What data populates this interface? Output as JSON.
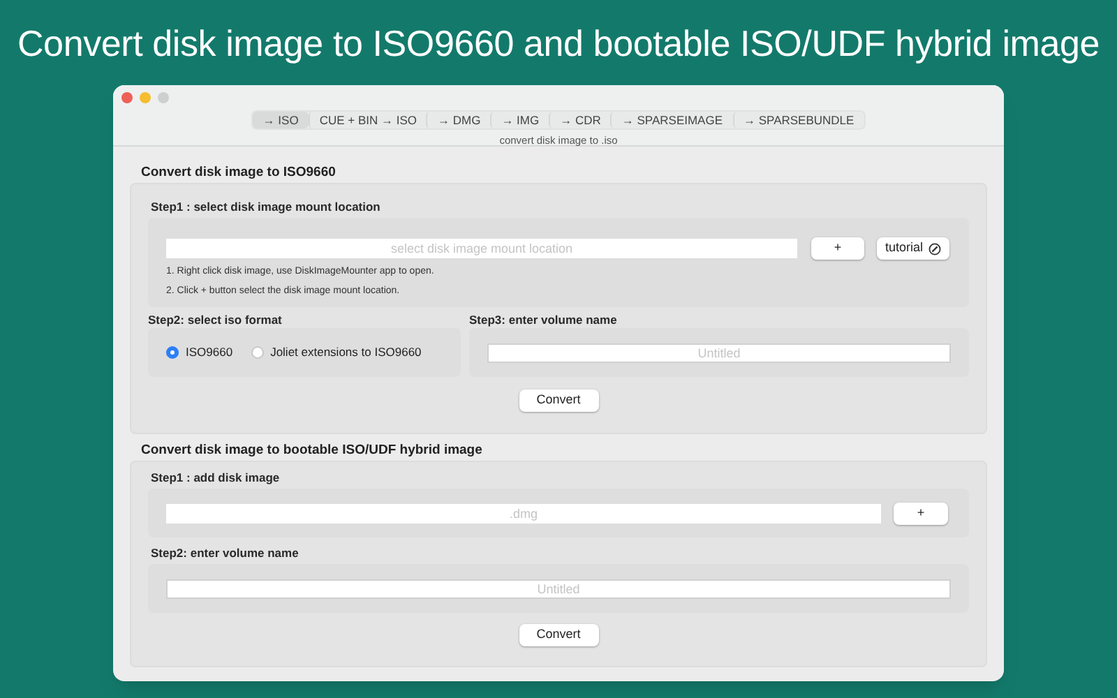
{
  "headline": "Convert disk image to ISO9660 and bootable ISO/UDF hybrid image",
  "window": {
    "tabs": [
      {
        "label": "→ ISO",
        "selected": true
      },
      {
        "label": "CUE + BIN → ISO",
        "selected": false
      },
      {
        "label": "→ DMG",
        "selected": false
      },
      {
        "label": "→ IMG",
        "selected": false
      },
      {
        "label": "→ CDR",
        "selected": false
      },
      {
        "label": "→ SPARSEIMAGE",
        "selected": false
      },
      {
        "label": "→ SPARSEBUNDLE",
        "selected": false
      }
    ],
    "subtitle": "convert disk image to .iso"
  },
  "iso_section": {
    "title": "Convert disk image to ISO9660",
    "step1": {
      "label": "Step1 : select disk image mount location",
      "placeholder": "select disk image mount location",
      "add_button": "+",
      "tutorial_button": "tutorial",
      "notes": [
        "1. Right click disk image, use DiskImageMounter app to open.",
        "2. Click + button select the disk image mount location."
      ]
    },
    "step2": {
      "label": "Step2: select iso format",
      "options": [
        {
          "label": "ISO9660",
          "selected": true
        },
        {
          "label": "Joliet extensions to ISO9660",
          "selected": false
        }
      ]
    },
    "step3": {
      "label": "Step3: enter volume name",
      "placeholder": "Untitled"
    },
    "convert_button": "Convert"
  },
  "hybrid_section": {
    "title": "Convert disk image to bootable ISO/UDF hybrid image",
    "step1": {
      "label": "Step1 : add disk image",
      "placeholder": ".dmg",
      "add_button": "+"
    },
    "step2": {
      "label": "Step2: enter volume name",
      "placeholder": "Untitled"
    },
    "convert_button": "Convert"
  }
}
